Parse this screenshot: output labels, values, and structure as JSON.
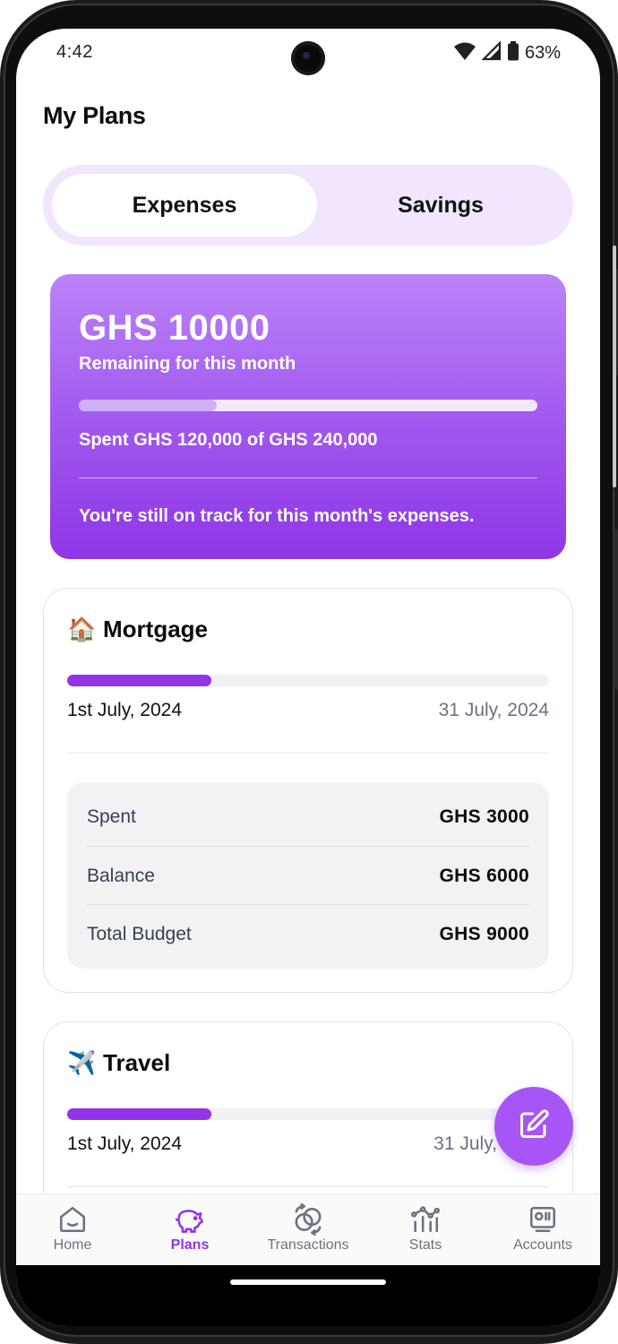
{
  "status_bar": {
    "time": "4:42",
    "battery": "63%"
  },
  "header": {
    "title": "My Plans"
  },
  "tabs": [
    {
      "label": "Expenses"
    },
    {
      "label": "Savings"
    }
  ],
  "summary": {
    "amount": "GHS 10000",
    "subtitle": "Remaining for this month",
    "progress": 0.3,
    "spent_text": "Spent GHS 120,000 of GHS 240,000",
    "note": "You're still on track for this month's expenses."
  },
  "plans": [
    {
      "emoji": "🏠",
      "name": "Mortgage",
      "progress": 0.3,
      "start": "1st July, 2024",
      "end": "31 July, 2024",
      "rows": [
        {
          "label": "Spent",
          "value": "GHS 3000"
        },
        {
          "label": "Balance",
          "value": "GHS 6000"
        },
        {
          "label": "Total Budget",
          "value": "GHS 9000"
        }
      ]
    },
    {
      "emoji": "✈️",
      "name": "Travel",
      "progress": 0.3,
      "start": "1st July, 2024",
      "end": "31 July,"
    }
  ],
  "fab": {
    "icon": "edit-icon"
  },
  "nav": {
    "items": [
      {
        "label": "Home",
        "icon": "home-icon"
      },
      {
        "label": "Plans",
        "icon": "piggy-bank-icon",
        "active": true
      },
      {
        "label": "Transactions",
        "icon": "transactions-icon"
      },
      {
        "label": "Stats",
        "icon": "stats-icon"
      },
      {
        "label": "Accounts",
        "icon": "accounts-icon"
      }
    ]
  },
  "colors": {
    "accent": "#9333ea",
    "tab_bg": "#f1e6fd",
    "card_gradient_top": "#bb82f8",
    "card_gradient_bottom": "#8f36e6"
  }
}
